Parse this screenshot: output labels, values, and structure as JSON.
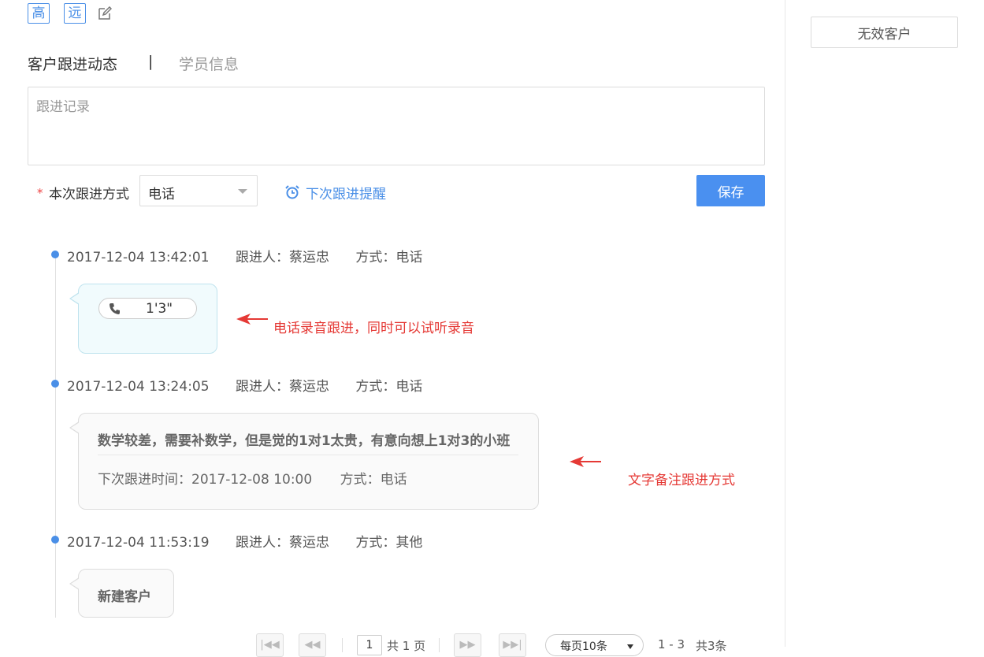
{
  "tags": [
    "高",
    "远"
  ],
  "tabs": {
    "active": "客户跟进动态",
    "separator": "|",
    "inactive": "学员信息"
  },
  "record": {
    "placeholder": "跟进记录"
  },
  "follow_method": {
    "required_mark": "*",
    "label": "本次跟进方式",
    "selected": "电话"
  },
  "reminder_link": "下次跟进提醒",
  "save_label": "保存",
  "right_panel": {
    "invalid_button": "无效客户"
  },
  "timeline": [
    {
      "time": "2017-12-04 13:42:01",
      "follower": "跟进人：蔡运忠",
      "method": "方式：电话",
      "audio_duration": "1'3\"",
      "annotation": "电话录音跟进，同时可以试听录音"
    },
    {
      "time": "2017-12-04 13:24:05",
      "follower": "跟进人：蔡运忠",
      "method": "方式：电话",
      "note": "数学较差，需要补数学，但是觉的1对1太贵，有意向想上1对3的小班",
      "next_time": "下次跟进时间：2017-12-08 10:00",
      "next_method": "方式：电话",
      "annotation": "文字备注跟进方式"
    },
    {
      "time": "2017-12-04 11:53:19",
      "follower": "跟进人：蔡运忠",
      "method": "方式：其他",
      "note": "新建客户"
    }
  ],
  "pagination": {
    "page": "1",
    "total_pages": "共 1 页",
    "page_size": "每页10条",
    "range": "1 - 3",
    "total": "共3条"
  },
  "colors": {
    "accent": "#4a8fe7",
    "primary_button": "#4a90f0",
    "annotation": "#e53935"
  }
}
